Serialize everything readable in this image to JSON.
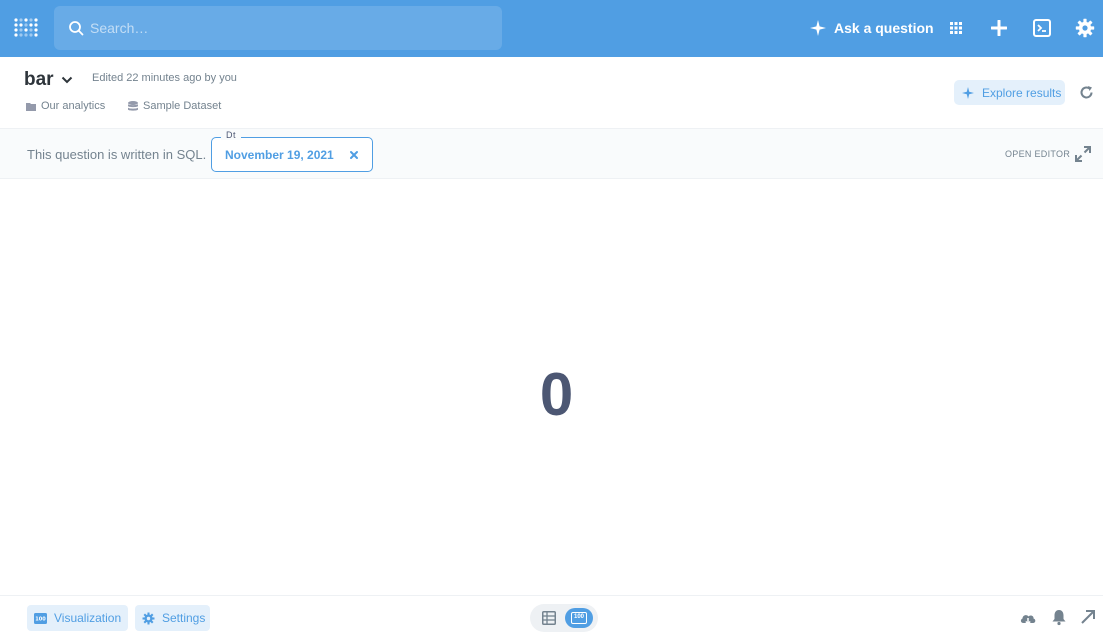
{
  "navbar": {
    "search_placeholder": "Search…",
    "ask_label": "Ask a question",
    "icons": [
      "metabase-logo-icon",
      "search-icon",
      "sparkle-icon",
      "grid-icon",
      "plus-icon",
      "terminal-icon",
      "gear-icon"
    ]
  },
  "header": {
    "title": "bar",
    "edited": "Edited 22 minutes ago by you",
    "collection": "Our analytics",
    "database": "Sample Dataset",
    "explore_label": "Explore results"
  },
  "filterbar": {
    "note": "This question is written in SQL.",
    "filter_name": "Dt",
    "filter_value": "November 19, 2021",
    "open_editor": "OPEN EDITOR"
  },
  "main": {
    "scalar_value": "0"
  },
  "footer": {
    "visualization_label": "Visualization",
    "settings_label": "Settings",
    "scalar_badge": "100"
  },
  "colors": {
    "brand": "#509ee3",
    "text_dark": "#2e353b",
    "text_medium": "#74838f",
    "scalar": "#4c5773",
    "brand_light": "#e4f0fb"
  }
}
